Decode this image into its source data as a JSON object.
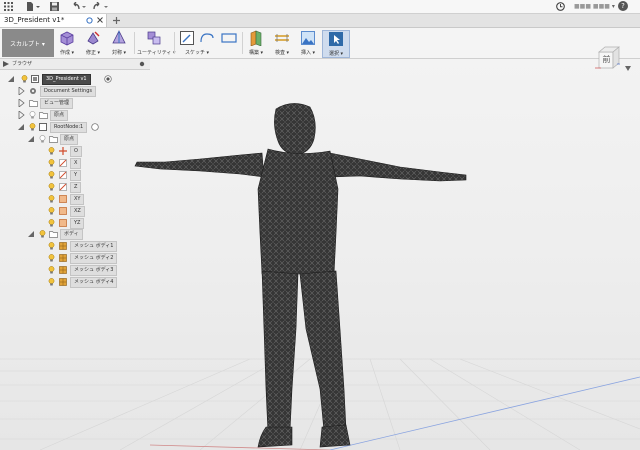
{
  "title_bar": {
    "user_label": "■■■ ■■■",
    "help_glyph": "?"
  },
  "tab": {
    "label": "3D_President v1*"
  },
  "workspace": {
    "label": "スカルプト ▾"
  },
  "ribbon": [
    {
      "label": "作成 ▾",
      "icon": "create-box-icon"
    },
    {
      "label": "修正 ▾",
      "icon": "modify-icon"
    },
    {
      "label": "対称 ▾",
      "icon": "symmetry-icon"
    },
    {
      "label": "ユーティリティ ▾",
      "icon": "utilities-icon"
    },
    {
      "label": "スケッチ ▾",
      "icon": "sketch-icon"
    },
    {
      "label": "構築 ▾",
      "icon": "construct-icon"
    },
    {
      "label": "検査 ▾",
      "icon": "inspect-icon"
    },
    {
      "label": "挿入 ▾",
      "icon": "insert-icon"
    },
    {
      "label": "選択 ▾",
      "icon": "select-icon"
    }
  ],
  "browser": {
    "title": "ブラウザ",
    "root": "3D_President v1",
    "document_settings": "Document Settings",
    "view_manager": "ビュー管理",
    "origin_top": "原点",
    "root_node": "RootNode:1",
    "origin_sub": "原点",
    "origin_items": [
      "O",
      "X",
      "Y",
      "Z",
      "XY",
      "XZ",
      "YZ"
    ],
    "bodies_folder": "ボディ",
    "bodies": [
      "メッシュ ボディ1",
      "メッシュ ボディ2",
      "メッシュ ボディ3",
      "メッシュ ボディ4"
    ]
  },
  "viewcube": {
    "face_label": "前"
  },
  "colors": {
    "accent_blue": "#3a74c4",
    "workspace_gray": "#8a8a8a",
    "mesh_dark": "#2e2e2e"
  }
}
